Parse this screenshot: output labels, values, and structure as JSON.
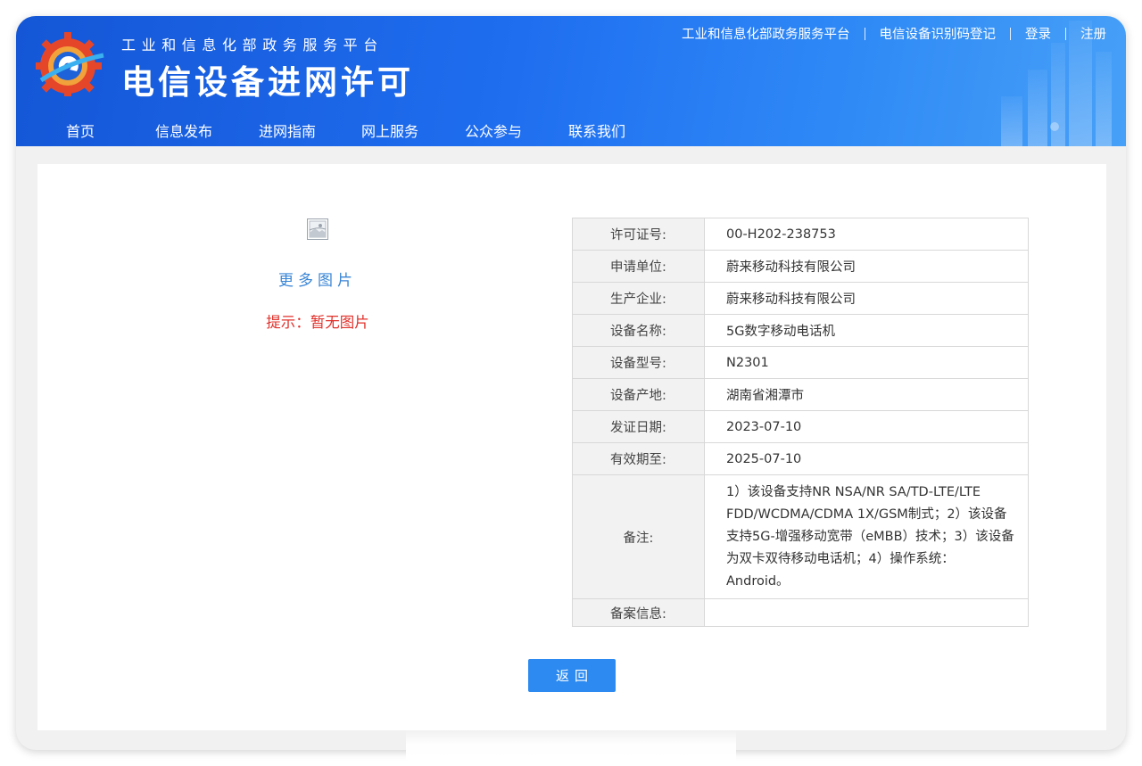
{
  "header": {
    "subtitle": "工业和信息化部政务服务平台",
    "title": "电信设备进网许可",
    "top_links": [
      {
        "label": "工业和信息化部政务服务平台"
      },
      {
        "label": "电信设备识别码登记"
      },
      {
        "label": "登录"
      },
      {
        "label": "注册"
      }
    ],
    "nav": [
      {
        "label": "首页"
      },
      {
        "label": "信息发布"
      },
      {
        "label": "进网指南"
      },
      {
        "label": "网上服务"
      },
      {
        "label": "公众参与"
      },
      {
        "label": "联系我们"
      }
    ]
  },
  "gallery": {
    "more_pictures": "更多图片",
    "hint": "提示：暂无图片",
    "image_icon": "broken-image-icon"
  },
  "details": [
    {
      "key": "许可证号:",
      "value": "00-H202-238753"
    },
    {
      "key": "申请单位:",
      "value": "蔚来移动科技有限公司"
    },
    {
      "key": "生产企业:",
      "value": "蔚来移动科技有限公司"
    },
    {
      "key": "设备名称:",
      "value": "5G数字移动电话机"
    },
    {
      "key": "设备型号:",
      "value": "N2301"
    },
    {
      "key": "设备产地:",
      "value": "湖南省湘潭市"
    },
    {
      "key": "发证日期:",
      "value": "2023-07-10"
    },
    {
      "key": "有效期至:",
      "value": "2025-07-10"
    },
    {
      "key": "备注:",
      "value": "1）该设备支持NR NSA/NR SA/TD-LTE/LTE FDD/WCDMA/CDMA 1X/GSM制式；2）该设备支持5G-增强移动宽带（eMBB）技术；3）该设备为双卡双待移动电话机；4）操作系统：Android。"
    },
    {
      "key": "备案信息:",
      "value": ""
    }
  ],
  "back_button": "返回",
  "colors": {
    "header_blue": "#1f6ef0",
    "link_blue": "#3a86d6",
    "hint_red": "#e0302a",
    "button_blue": "#2c8af0"
  }
}
